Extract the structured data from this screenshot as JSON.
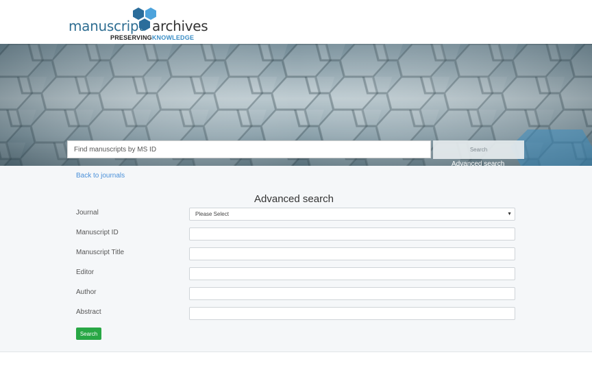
{
  "logo": {
    "word1": "manuscript",
    "word2": "archives",
    "tagline_a": "PRESERVING",
    "tagline_b": "KNOWLEDGE",
    "colors": {
      "primary": "#2f6e92",
      "accent": "#3a8ec6",
      "hex_light": "#4da3dc",
      "hex_dark": "#2b6d9b"
    }
  },
  "hero": {
    "search_placeholder": "Find manuscripts by MS ID",
    "search_button": "Search",
    "advanced_link": "Advanced search"
  },
  "content": {
    "back_link": "Back to journals",
    "title": "Advanced search",
    "fields": [
      {
        "label": "Journal",
        "type": "select",
        "value": "Please Select"
      },
      {
        "label": "Manuscript ID",
        "type": "text",
        "value": ""
      },
      {
        "label": "Manuscript Title",
        "type": "text",
        "value": ""
      },
      {
        "label": "Editor",
        "type": "text",
        "value": ""
      },
      {
        "label": "Author",
        "type": "text",
        "value": ""
      },
      {
        "label": "Abstract",
        "type": "text",
        "value": ""
      }
    ],
    "search_button": "Search",
    "colors": {
      "link": "#4a90d9",
      "button": "#28a745"
    }
  }
}
